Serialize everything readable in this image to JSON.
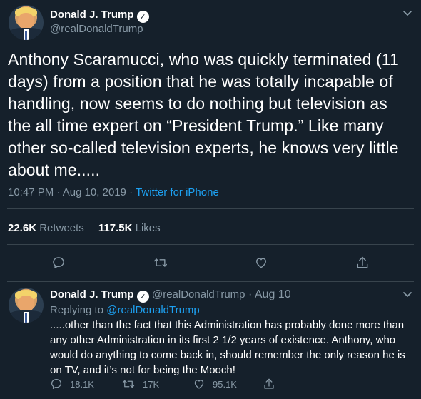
{
  "main_tweet": {
    "author_name": "Donald J. Trump",
    "author_handle": "@realDonaldTrump",
    "text": "Anthony Scaramucci, who was quickly terminated (11 days) from a position that he was totally incapable of handling, now seems to do nothing but television as the all time expert on “President Trump.” Like many other so-called television experts, he knows very little about me.....",
    "time": "10:47 PM",
    "date": "Aug 10, 2019",
    "separator": "·",
    "source": "Twitter for iPhone",
    "retweets_count": "22.6K",
    "retweets_label": "Retweets",
    "likes_count": "117.5K",
    "likes_label": "Likes"
  },
  "reply_tweet": {
    "author_name": "Donald J. Trump",
    "author_handle": "@realDonaldTrump",
    "separator": "·",
    "date": "Aug 10",
    "replying_to_label": "Replying to",
    "replying_to_handle": "@realDonaldTrump",
    "text": ".....other than the fact that this Administration has probably done more than any other Administration in its first 2 1/2 years of existence. Anthony, who would do anything to come back in, should remember the only reason he is on TV, and it’s not for being the Mooch!",
    "reply_count": "18.1K",
    "retweet_count": "17K",
    "like_count": "95.1K"
  },
  "icons": {
    "verified": "verified-badge-icon",
    "caret": "chevron-down-icon",
    "reply": "comment-icon",
    "retweet": "retweet-icon",
    "like": "heart-icon",
    "share": "share-icon"
  },
  "colors": {
    "background": "#15202b",
    "text": "#ffffff",
    "muted": "#8899a6",
    "link": "#1da1f2",
    "divider": "#38444d"
  }
}
